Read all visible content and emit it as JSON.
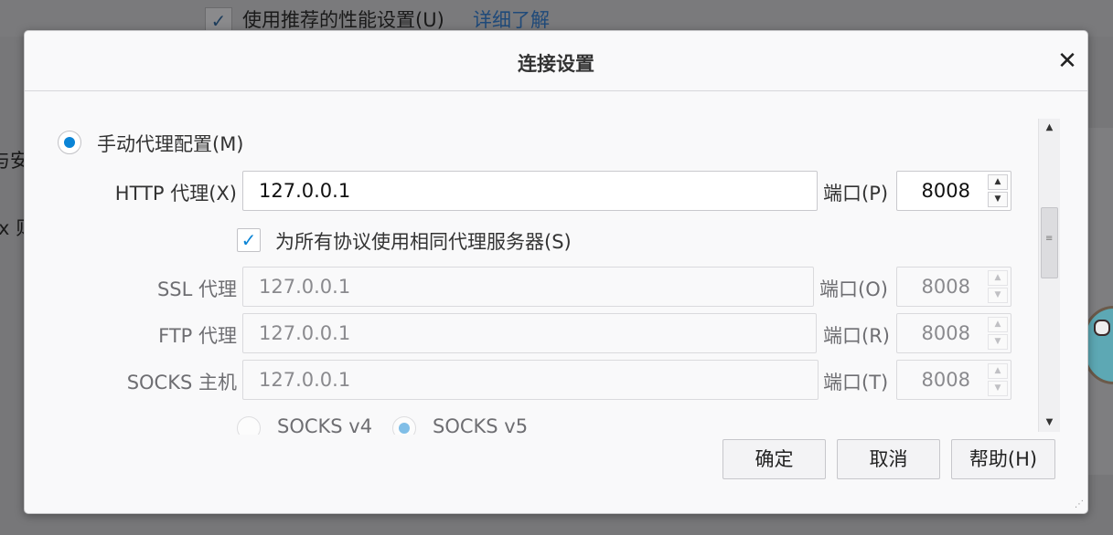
{
  "background": {
    "use_recommended_label": "使用推荐的性能设置(U)",
    "learn_more_link": "详细了解",
    "fragment_1": "与安",
    "fragment_2": "x 则"
  },
  "dialog": {
    "title": "连接设置",
    "close_icon": "close-icon",
    "manual_proxy_label": "手动代理配置(M)",
    "http": {
      "label": "HTTP 代理(X)",
      "value": "127.0.0.1",
      "port_label": "端口(P)",
      "port": "8008"
    },
    "same_proxy_label": "为所有协议使用相同代理服务器(S)",
    "ssl": {
      "label": "SSL 代理",
      "value": "127.0.0.1",
      "port_label": "端口(O)",
      "port": "8008"
    },
    "ftp": {
      "label": "FTP 代理",
      "value": "127.0.0.1",
      "port_label": "端口(R)",
      "port": "8008"
    },
    "socks": {
      "label": "SOCKS 主机",
      "value": "127.0.0.1",
      "port_label": "端口(T)",
      "port": "8008"
    },
    "socks_v4": "SOCKS v4",
    "socks_v5": "SOCKS v5",
    "buttons": {
      "ok": "确定",
      "cancel": "取消",
      "help": "帮助(H)"
    }
  },
  "colors": {
    "accent": "#0a84d6",
    "link": "#1f4a7a"
  }
}
